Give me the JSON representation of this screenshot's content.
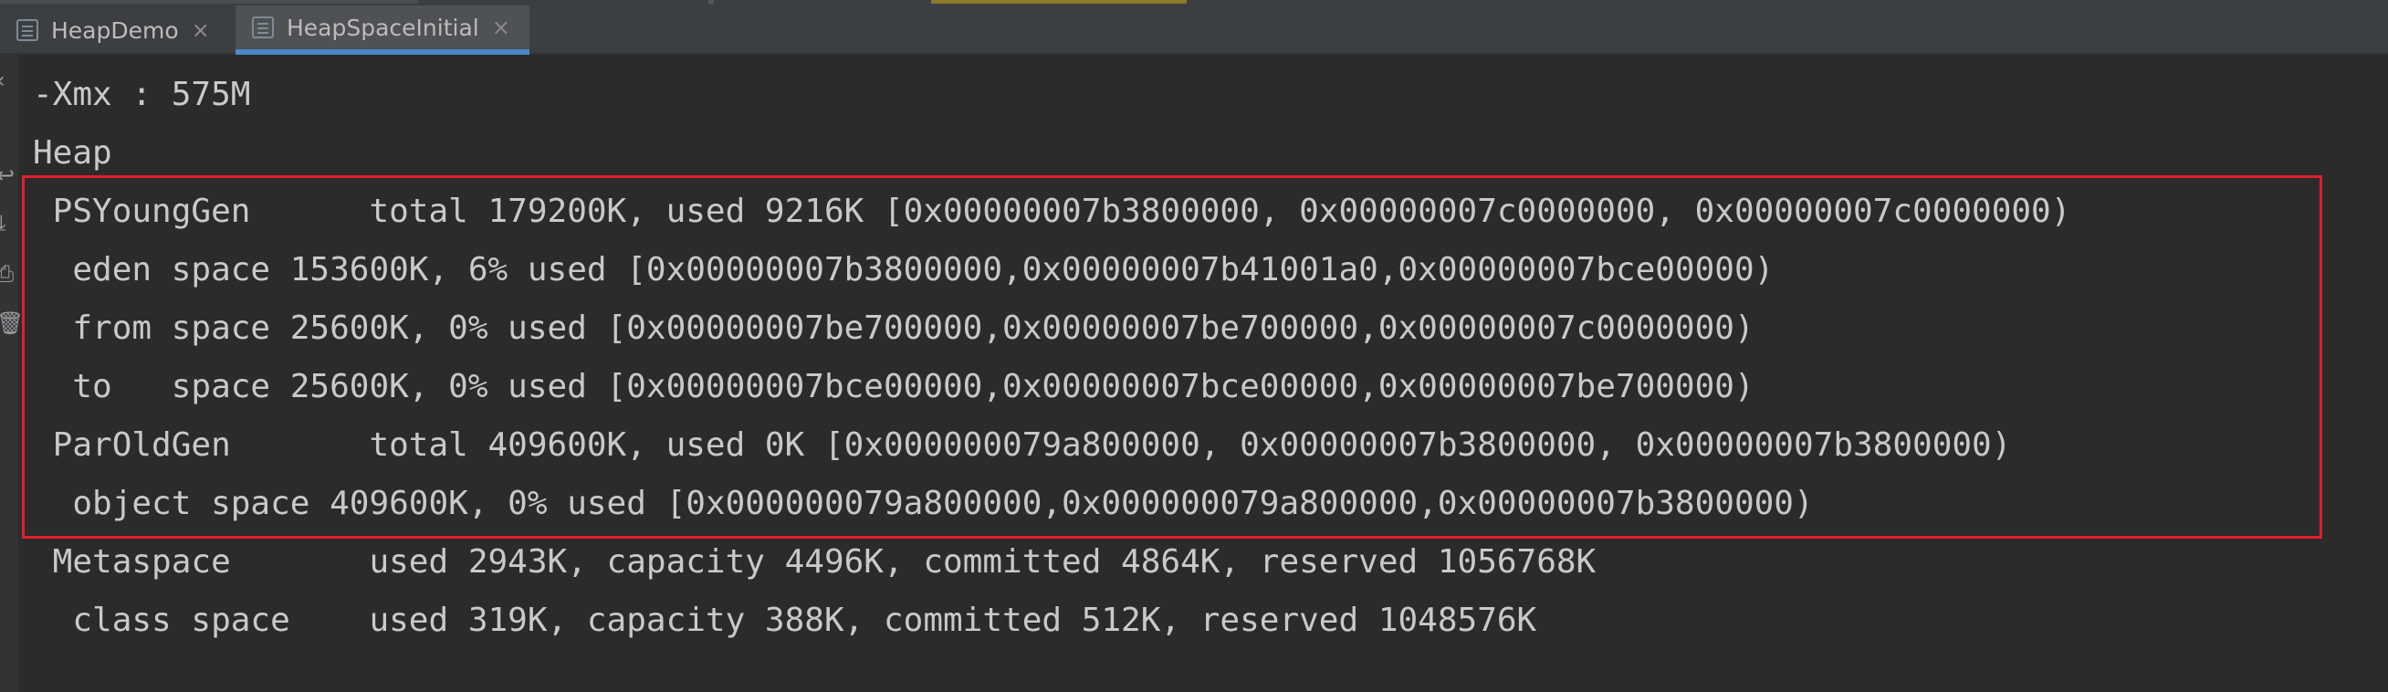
{
  "tabs": [
    {
      "label": "HeapDemo",
      "active": false
    },
    {
      "label": "HeapSpaceInitial",
      "active": true
    }
  ],
  "gutter_icons": [
    "soft-wrap-icon",
    "scroll-to-end-icon",
    "print-icon",
    "trash-icon"
  ],
  "console": {
    "lines": [
      "-Xmx : 575M",
      "Heap",
      " PSYoungGen      total 179200K, used 9216K [0x00000007b3800000, 0x00000007c0000000, 0x00000007c0000000)",
      "  eden space 153600K, 6% used [0x00000007b3800000,0x00000007b41001a0,0x00000007bce00000)",
      "  from space 25600K, 0% used [0x00000007be700000,0x00000007be700000,0x00000007c0000000)",
      "  to   space 25600K, 0% used [0x00000007bce00000,0x00000007bce00000,0x00000007be700000)",
      " ParOldGen       total 409600K, used 0K [0x000000079a800000, 0x00000007b3800000, 0x00000007b3800000)",
      "  object space 409600K, 0% used [0x000000079a800000,0x000000079a800000,0x00000007b3800000)",
      " Metaspace       used 2943K, capacity 4496K, committed 4864K, reserved 1056768K",
      "  class space    used 319K, capacity 388K, committed 512K, reserved 1048576K"
    ]
  },
  "colors": {
    "background": "#2b2b2b",
    "text": "#c9c9c9",
    "highlight_border": "#e0202c",
    "active_tab_underline": "#4a88c7"
  }
}
